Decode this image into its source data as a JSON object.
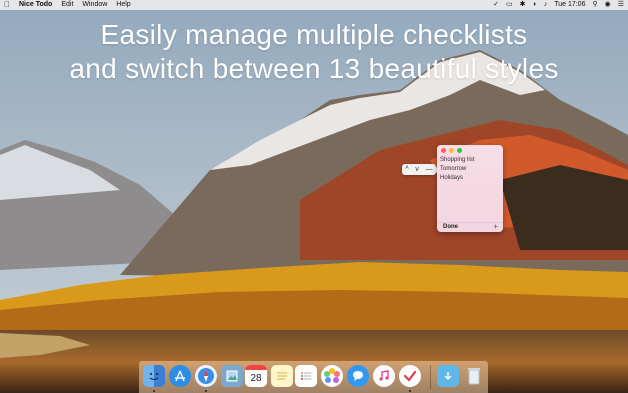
{
  "menubar": {
    "apple": "",
    "app_name": "Nice Todo",
    "menus": [
      "Edit",
      "Window",
      "Help"
    ],
    "clock": "Tue 17:06"
  },
  "headline": {
    "line1": "Easily manage multiple checklists",
    "line2": "and switch between 13 beautiful styles"
  },
  "todo_window": {
    "items": [
      "Shopping list",
      "Tomorrow",
      "Holidays"
    ],
    "done_label": "Done",
    "add_label": "+"
  },
  "popover": {
    "up": "^",
    "down": "v",
    "more": "—"
  },
  "colors": {
    "traffic_red": "#ff5f57",
    "traffic_yellow": "#febc2e",
    "traffic_green": "#28c840",
    "window_bg": "#f5d9e3"
  },
  "dock": {
    "apps": [
      "finder-icon",
      "app-store-icon",
      "safari-icon",
      "preview-icon",
      "calendar-icon",
      "notes-icon",
      "reminders-icon",
      "photos-icon",
      "messages-icon",
      "itunes-icon",
      "nice-todo-icon",
      "downloads-folder-icon",
      "trash-icon"
    ],
    "calendar_day": "28"
  }
}
